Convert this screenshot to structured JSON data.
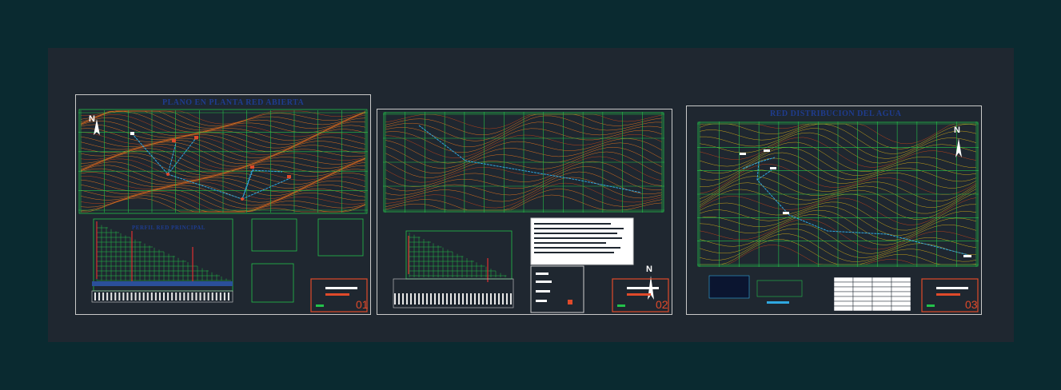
{
  "sheets": [
    {
      "title": "PLANO EN PLANTA RED ABIERTA",
      "subtitle": "PERFIL RED PRINCIPAL",
      "number": "01"
    },
    {
      "title": "",
      "subtitle": "",
      "number": "02"
    },
    {
      "title": "RED DISTRIBUCION DEL AGUA",
      "subtitle": "",
      "number": "03"
    }
  ],
  "north_label": "N",
  "colors": {
    "background": "#0a2a30",
    "model_space": "#1f2730",
    "grid": "#23c24a",
    "contour_orange": "#d9701f",
    "contour_red": "#b8421a",
    "contour_yellow": "#c8a21a",
    "pipeline": "#2fa8e0",
    "title_text": "#1f3c8f",
    "title_block_border": "#e04a2a"
  }
}
